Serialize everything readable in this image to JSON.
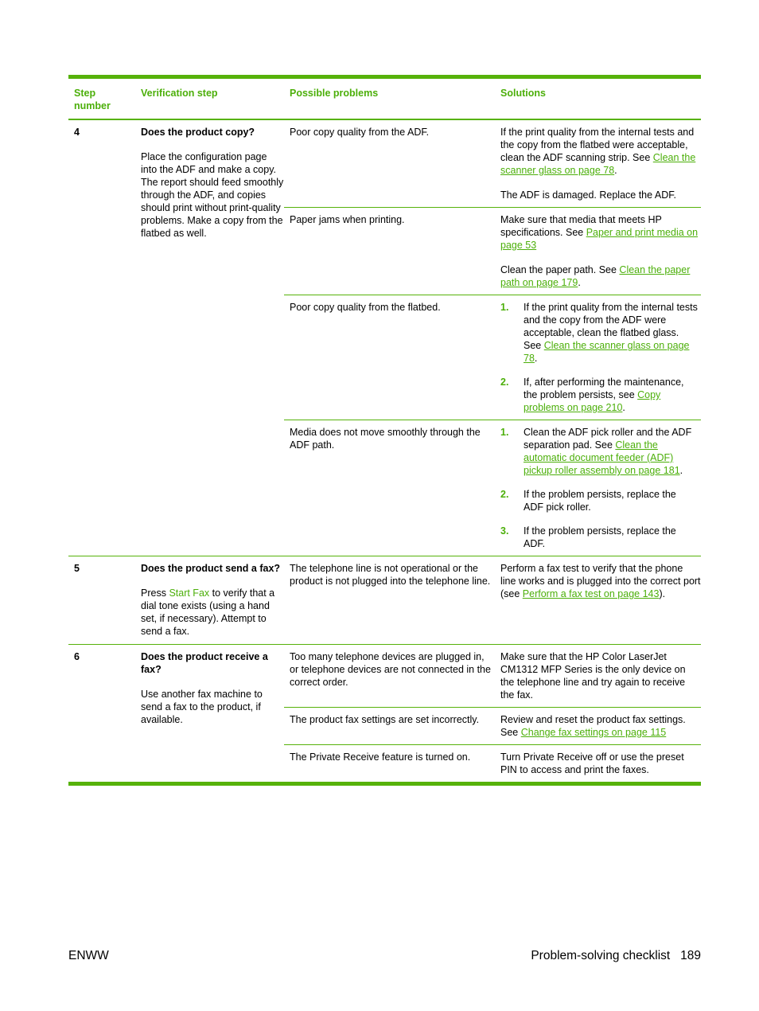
{
  "table": {
    "headers": {
      "step": "Step number",
      "verification": "Verification step",
      "problems": "Possible problems",
      "solutions": "Solutions"
    },
    "steps": [
      {
        "number": "4",
        "question": "Does the product copy?",
        "description": "Place the configuration page into the ADF and make a copy. The report should feed smoothly through the ADF, and copies should print without print-quality problems. Make a copy from the flatbed as well.",
        "rows": [
          {
            "problem": "Poor copy quality from the ADF.",
            "sol_a_pre": "If the print quality from the internal tests and the copy from the flatbed were acceptable, clean the ADF scanning strip. See ",
            "sol_a_link": "Clean the scanner glass on page 78",
            "sol_a_post": ".",
            "sol_b": "The ADF is damaged. Replace the ADF."
          },
          {
            "problem": "Paper jams when printing.",
            "sol_a_pre": "Make sure that media that meets HP specifications. See ",
            "sol_a_link": "Paper and print media on page 53",
            "sol_a_post": "",
            "sol_b_pre": "Clean the paper path. See ",
            "sol_b_link": "Clean the paper path on page 179",
            "sol_b_post": "."
          },
          {
            "problem": "Poor copy quality from the flatbed.",
            "items": [
              {
                "n": "1.",
                "pre": "If the print quality from the internal tests and the copy from the ADF were acceptable, clean the flatbed glass. See ",
                "link": "Clean the scanner glass on page 78",
                "post": "."
              },
              {
                "n": "2.",
                "pre": "If, after performing the maintenance, the problem persists, see ",
                "link": "Copy problems on page 210",
                "post": "."
              }
            ]
          },
          {
            "problem": "Media does not move smoothly through the ADF path.",
            "items": [
              {
                "n": "1.",
                "pre": "Clean the ADF pick roller and the ADF separation pad. See ",
                "link": "Clean the automatic document feeder (ADF) pickup roller assembly on page 181",
                "post": "."
              },
              {
                "n": "2.",
                "pre": "If the problem persists, replace the ADF pick roller.",
                "link": "",
                "post": ""
              },
              {
                "n": "3.",
                "pre": "If the problem persists, replace the ADF.",
                "link": "",
                "post": ""
              }
            ]
          }
        ]
      },
      {
        "number": "5",
        "question": "Does the product send a fax?",
        "desc_pre": "Press ",
        "desc_link": "Start Fax",
        "desc_post": " to verify that a dial tone exists (using a hand set, if necessary). Attempt to send a fax.",
        "rows": [
          {
            "problem": "The telephone line is not operational or the product is not plugged into the telephone line.",
            "sol_a_pre": "Perform a fax test to verify that the phone line works and is plugged into the correct port (see ",
            "sol_a_link": "Perform a fax test on page 143",
            "sol_a_post": ")."
          }
        ]
      },
      {
        "number": "6",
        "question": "Does the product receive a fax?",
        "description": "Use another fax machine to send a fax to the product, if available.",
        "rows": [
          {
            "problem": "Too many telephone devices are plugged in, or telephone devices are not connected in the correct order.",
            "sol_a_pre": "Make sure that the HP Color LaserJet CM1312 MFP Series is the only device on the telephone line and try again to receive the fax."
          },
          {
            "problem": "The product fax settings are set incorrectly.",
            "sol_a_pre": "Review and reset the product fax settings. See ",
            "sol_a_link": "Change fax settings on page 115"
          },
          {
            "problem": "The Private Receive feature is turned on.",
            "sol_a_pre": "Turn Private Receive off or use the preset PIN to access and print the faxes."
          }
        ]
      }
    ]
  },
  "footer": {
    "left": "ENWW",
    "right": "Problem-solving checklist   189"
  },
  "colors": {
    "accent": "#56b20a",
    "link": "#4caf0a"
  }
}
